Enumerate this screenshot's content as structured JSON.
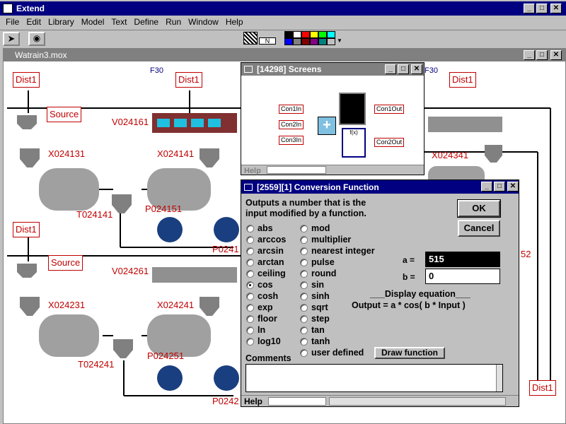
{
  "app": {
    "title": "Extend"
  },
  "menu": [
    "File",
    "Edit",
    "Library",
    "Model",
    "Text",
    "Define",
    "Run",
    "Window",
    "Help"
  ],
  "toolbar": {
    "n_label": "N",
    "palette": [
      "#000000",
      "#ffffff",
      "#ff0000",
      "#ffff00",
      "#00ff00",
      "#00ffff",
      "#0000ff",
      "#808080",
      "#800000",
      "#800080",
      "#008080",
      "#c0c0c0"
    ]
  },
  "model": {
    "title": "Watrain3.mox",
    "labels": {
      "dist1_a": "Dist1",
      "dist1_b": "Dist1",
      "dist1_c": "Dist1",
      "dist1_d": "Dist1",
      "dist1_e": "Dist1",
      "f30_a": "F30",
      "f30_b": "F30",
      "source_a": "Source",
      "source_b": "Source",
      "v024161": "V024161",
      "x024131": "X024131",
      "x024141": "X024141",
      "t024141": "T024141",
      "p024151": "P024151",
      "p0241": "P0241",
      "v024261": "V024261",
      "x024231": "X024231",
      "x024241": "X024241",
      "t024241": "T024241",
      "p024251": "P024251",
      "p0242": "P0242",
      "x024341": "X024341",
      "num52": "52"
    }
  },
  "screens": {
    "title": "[14298]   Screens",
    "inputs": [
      "Con1In",
      "Con2In",
      "Con3In"
    ],
    "outputs": [
      "Con1Out",
      "Con2Out"
    ],
    "fx": "f(x)",
    "help": "Help"
  },
  "dialog": {
    "title": "[2559][1]    Conversion Function",
    "description": "Outputs a number that is the input modified by a function.",
    "ok": "OK",
    "cancel": "Cancel",
    "col1": [
      "abs",
      "arccos",
      "arcsin",
      "arctan",
      "ceiling",
      "cos",
      "cosh",
      "exp",
      "floor",
      "ln",
      "log10"
    ],
    "col2": [
      "mod",
      "multiplier",
      "nearest integer",
      "pulse",
      "round",
      "sin",
      "sinh",
      "sqrt",
      "step",
      "tan",
      "tanh",
      "user defined"
    ],
    "selected": "cos",
    "a_label": "a =",
    "a_value": "515",
    "b_label": "b =",
    "b_value": "0",
    "eq_title": "___Display equation___",
    "eq_text": "Output = a * cos( b * Input )",
    "draw_button": "Draw function",
    "comments_label": "Comments",
    "help": "Help"
  }
}
